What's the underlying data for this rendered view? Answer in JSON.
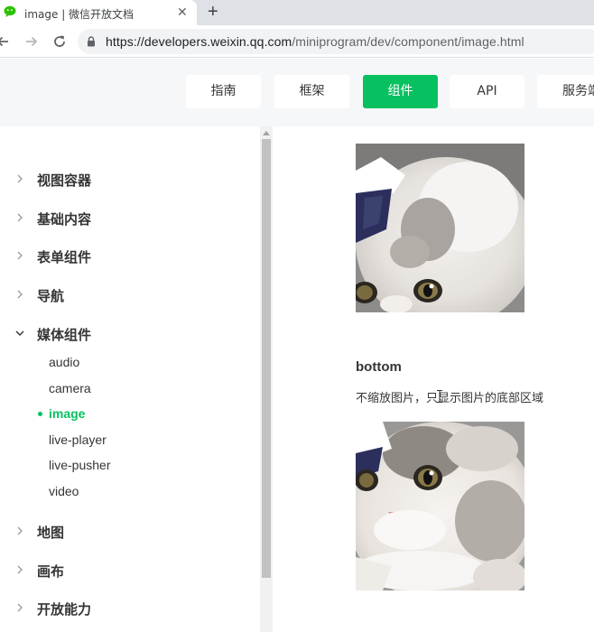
{
  "browser": {
    "tab_title": "image | 微信开放文档",
    "new_tab": "+",
    "close": "✕",
    "url_host": "https://developers.weixin.qq.com",
    "url_path": "/miniprogram/dev/component/image.html"
  },
  "topnav": {
    "items": [
      "指南",
      "框架",
      "组件",
      "API",
      "服务端"
    ],
    "active_index": 2
  },
  "sidebar": {
    "categories": [
      {
        "label": "视图容器",
        "expanded": false
      },
      {
        "label": "基础内容",
        "expanded": false
      },
      {
        "label": "表单组件",
        "expanded": false
      },
      {
        "label": "导航",
        "expanded": false
      },
      {
        "label": "媒体组件",
        "expanded": true
      },
      {
        "label": "地图",
        "expanded": false
      },
      {
        "label": "画布",
        "expanded": false
      },
      {
        "label": "开放能力",
        "expanded": false
      }
    ],
    "media_items": [
      "audio",
      "camera",
      "image",
      "live-player",
      "live-pusher",
      "video"
    ],
    "active_item": "image"
  },
  "main": {
    "section_title": "bottom",
    "section_desc": "不缩放图片，只显示图片的底部区域"
  },
  "colors": {
    "accent": "#07c160",
    "text": "#353535",
    "nav_bg": "#f6f7f8"
  }
}
